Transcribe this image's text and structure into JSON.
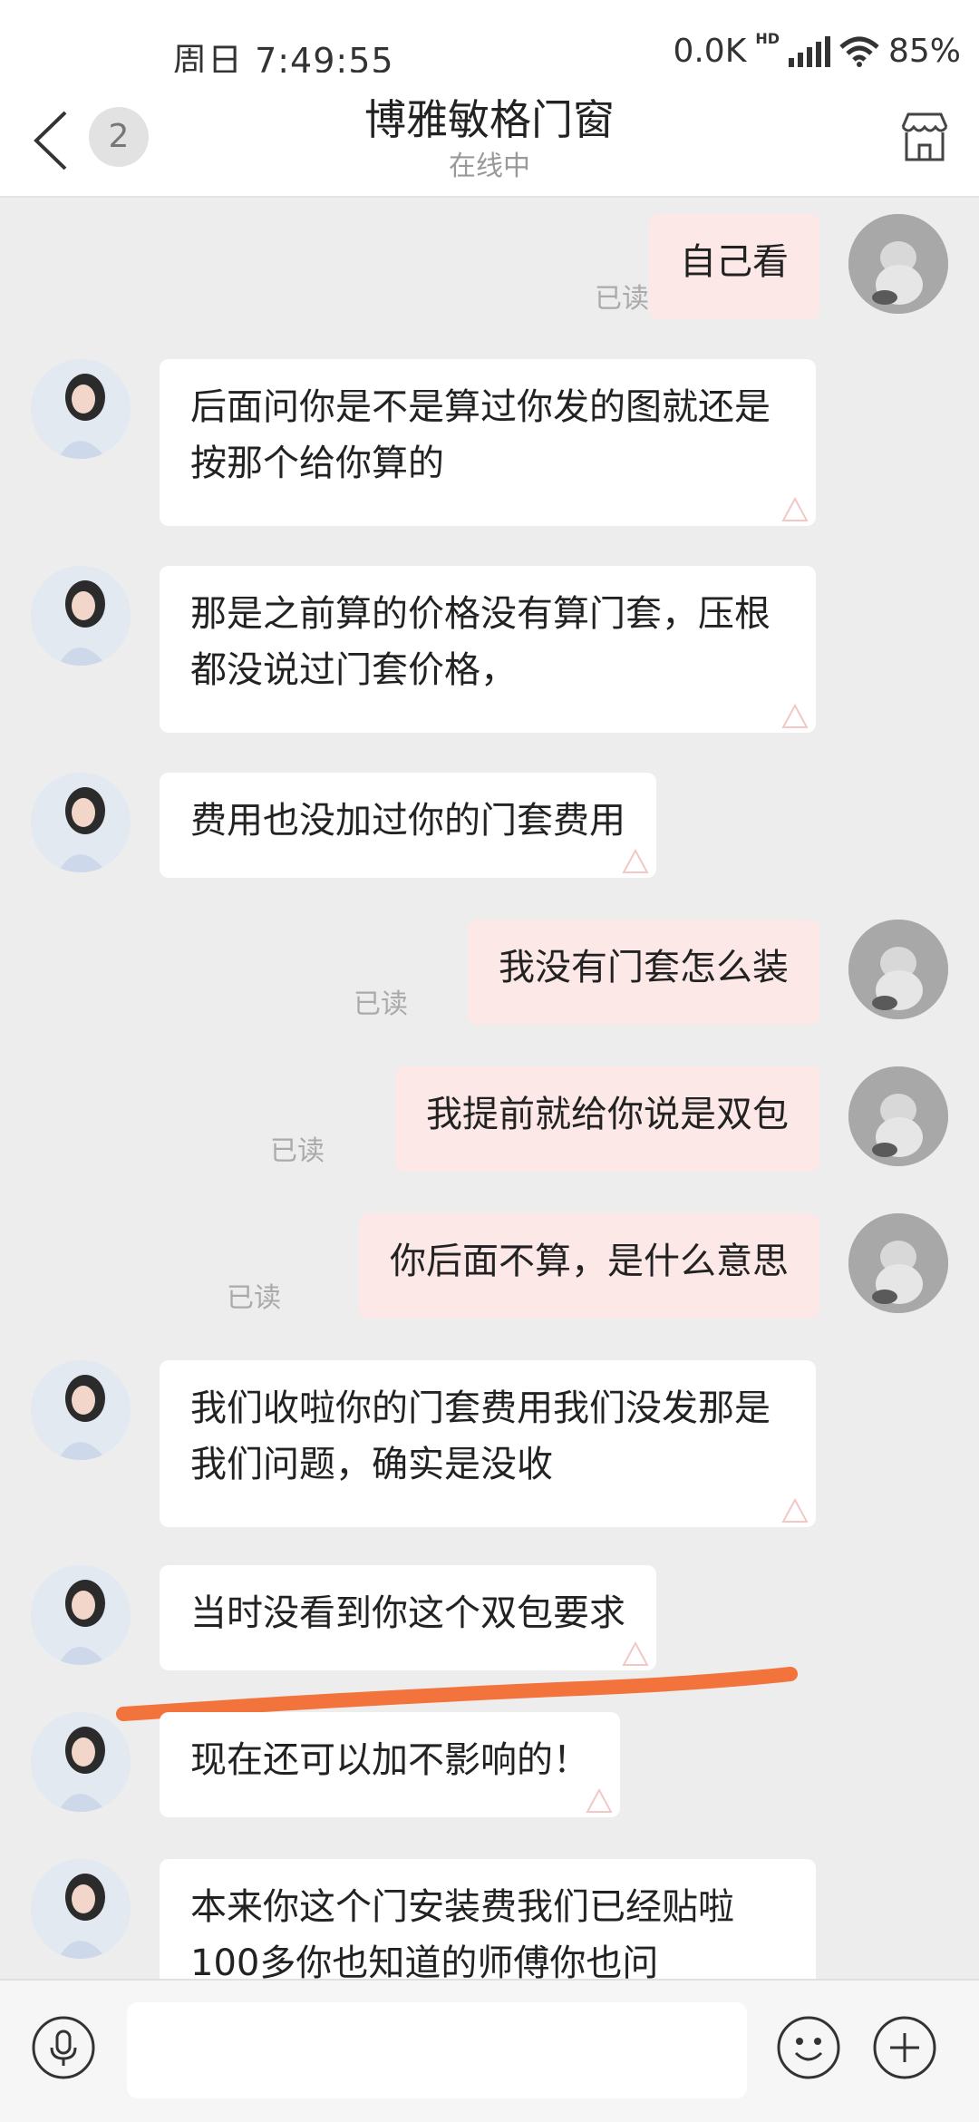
{
  "status_bar": {
    "time": "周日 7:49:55",
    "net_speed": "0.0K",
    "net_type": "HD",
    "battery": "85%"
  },
  "header": {
    "unread_count": "2",
    "title": "博雅敏格门窗",
    "status": "在线中"
  },
  "read_label": "已读",
  "messages": [
    {
      "from": "me",
      "text": "自己看"
    },
    {
      "from": "seller",
      "text": "后面问你是不是算过你发的图就还是按那个给你算的"
    },
    {
      "from": "seller",
      "text": "那是之前算的价格没有算门套，压根都没说过门套价格，"
    },
    {
      "from": "seller",
      "text": "费用也没加过你的门套费用"
    },
    {
      "from": "me",
      "text": "我没有门套怎么装"
    },
    {
      "from": "me",
      "text": "我提前就给你说是双包"
    },
    {
      "from": "me",
      "text": "你后面不算，是什么意思"
    },
    {
      "from": "seller",
      "text": "我们收啦你的门套费用我们没发那是我们问题，确实是没收"
    },
    {
      "from": "seller",
      "text": "当时没看到你这个双包要求"
    },
    {
      "from": "seller",
      "text": "现在还可以加不影响的！"
    },
    {
      "from": "seller",
      "text": "本来你这个门安装费我们已经贴啦100多你也知道的师傅你也问"
    }
  ],
  "colors": {
    "bubble_in": "#ffffff",
    "bubble_out": "#fde8e8",
    "background": "#ededed",
    "annotation": "#f2733c"
  }
}
